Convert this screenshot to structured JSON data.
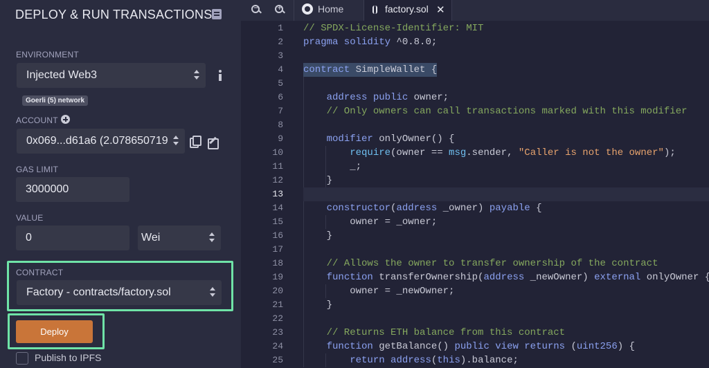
{
  "left_panel": {
    "title": "DEPLOY & RUN TRANSACTIONS",
    "environment": {
      "label": "ENVIRONMENT",
      "value": "Injected Web3",
      "network_badge": "Goerli (5) network"
    },
    "account": {
      "label": "ACCOUNT",
      "value": "0x069...d61a6 (2.078650719"
    },
    "gas_limit": {
      "label": "GAS LIMIT",
      "value": "3000000"
    },
    "value": {
      "label": "VALUE",
      "amount": "0",
      "unit": "Wei"
    },
    "contract": {
      "label": "CONTRACT",
      "value": "Factory - contracts/factory.sol"
    },
    "deploy_label": "Deploy",
    "publish_label": "Publish to IPFS",
    "highlight_color": "#6fe3a7",
    "deploy_color": "#c97539"
  },
  "editor": {
    "tabs": [
      {
        "label": "Home"
      },
      {
        "label": "factory.sol",
        "close": "✕"
      }
    ],
    "zoom_out_glyph": "−",
    "zoom_in_glyph": "+",
    "current_line": 13,
    "lines": [
      {
        "n": "1",
        "tokens": [
          {
            "t": "// SPDX-License-Identifier: MIT",
            "c": "com"
          }
        ]
      },
      {
        "n": "2",
        "tokens": [
          {
            "t": "pragma solidity",
            "c": "kw"
          },
          {
            "t": " ^0.8.0;",
            "c": ""
          }
        ]
      },
      {
        "n": "3",
        "tokens": []
      },
      {
        "n": "4",
        "tokens": [
          {
            "t": "contract",
            "c": "kw"
          },
          {
            "t": " SimpleWallet {",
            "c": ""
          }
        ]
      },
      {
        "n": "5",
        "tokens": []
      },
      {
        "n": "6",
        "tokens": [
          {
            "t": "    ",
            "c": ""
          },
          {
            "t": "address public",
            "c": "kw"
          },
          {
            "t": " owner;",
            "c": ""
          }
        ]
      },
      {
        "n": "7",
        "tokens": [
          {
            "t": "    // Only owners can call transactions marked with this modifier",
            "c": "com"
          }
        ]
      },
      {
        "n": "8",
        "tokens": []
      },
      {
        "n": "9",
        "tokens": [
          {
            "t": "    ",
            "c": ""
          },
          {
            "t": "modifier",
            "c": "kw"
          },
          {
            "t": " onlyOwner() {",
            "c": ""
          }
        ]
      },
      {
        "n": "10",
        "tokens": [
          {
            "t": "        ",
            "c": ""
          },
          {
            "t": "require",
            "c": "typ"
          },
          {
            "t": "(owner == ",
            "c": ""
          },
          {
            "t": "msg",
            "c": "typ"
          },
          {
            "t": ".sender, ",
            "c": ""
          },
          {
            "t": "\"Caller is not the owner\"",
            "c": "str"
          },
          {
            "t": ");",
            "c": ""
          }
        ]
      },
      {
        "n": "11",
        "tokens": [
          {
            "t": "        _;",
            "c": ""
          }
        ]
      },
      {
        "n": "12",
        "tokens": [
          {
            "t": "    }",
            "c": ""
          }
        ]
      },
      {
        "n": "13",
        "tokens": []
      },
      {
        "n": "14",
        "tokens": [
          {
            "t": "    ",
            "c": ""
          },
          {
            "t": "constructor",
            "c": "kw"
          },
          {
            "t": "(",
            "c": ""
          },
          {
            "t": "address",
            "c": "kw"
          },
          {
            "t": " _owner) ",
            "c": ""
          },
          {
            "t": "payable",
            "c": "kw"
          },
          {
            "t": " {",
            "c": ""
          }
        ]
      },
      {
        "n": "15",
        "tokens": [
          {
            "t": "        owner = _owner;",
            "c": ""
          }
        ]
      },
      {
        "n": "16",
        "tokens": [
          {
            "t": "    }",
            "c": ""
          }
        ]
      },
      {
        "n": "17",
        "tokens": []
      },
      {
        "n": "18",
        "tokens": [
          {
            "t": "    // Allows the owner to transfer ownership of the contract",
            "c": "com"
          }
        ]
      },
      {
        "n": "19",
        "tokens": [
          {
            "t": "    ",
            "c": ""
          },
          {
            "t": "function",
            "c": "kw"
          },
          {
            "t": " transferOwnership(",
            "c": ""
          },
          {
            "t": "address",
            "c": "kw"
          },
          {
            "t": " _newOwner) ",
            "c": ""
          },
          {
            "t": "external",
            "c": "kw"
          },
          {
            "t": " onlyOwner {",
            "c": ""
          }
        ]
      },
      {
        "n": "20",
        "tokens": [
          {
            "t": "        owner = _newOwner;",
            "c": ""
          }
        ]
      },
      {
        "n": "21",
        "tokens": [
          {
            "t": "    }",
            "c": ""
          }
        ]
      },
      {
        "n": "22",
        "tokens": []
      },
      {
        "n": "23",
        "tokens": [
          {
            "t": "    // Returns ETH balance from this contract",
            "c": "com"
          }
        ]
      },
      {
        "n": "24",
        "tokens": [
          {
            "t": "    ",
            "c": ""
          },
          {
            "t": "function",
            "c": "kw"
          },
          {
            "t": " getBalance() ",
            "c": ""
          },
          {
            "t": "public view returns",
            "c": "kw"
          },
          {
            "t": " (",
            "c": ""
          },
          {
            "t": "uint256",
            "c": "kw"
          },
          {
            "t": ") {",
            "c": ""
          }
        ]
      },
      {
        "n": "25",
        "tokens": [
          {
            "t": "        ",
            "c": ""
          },
          {
            "t": "return",
            "c": "kw"
          },
          {
            "t": " ",
            "c": ""
          },
          {
            "t": "address",
            "c": "kw"
          },
          {
            "t": "(",
            "c": ""
          },
          {
            "t": "this",
            "c": "kw"
          },
          {
            "t": ").balance;",
            "c": ""
          }
        ]
      }
    ]
  }
}
